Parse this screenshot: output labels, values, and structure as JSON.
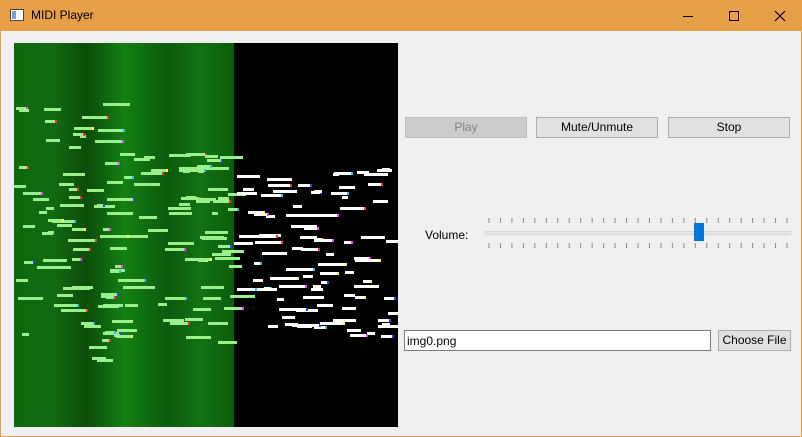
{
  "window": {
    "title": "MIDI Player",
    "titlebar_color": "#e8a048",
    "icons": {
      "app": "app-window-icon",
      "minimize": "minimize-icon",
      "maximize": "maximize-icon",
      "close": "close-icon"
    }
  },
  "controls": {
    "play_label": "Play",
    "play_enabled": false,
    "mute_label": "Mute/Unmute",
    "stop_label": "Stop"
  },
  "volume": {
    "label": "Volume:",
    "value": 0.7,
    "accent": "#0078d7"
  },
  "file": {
    "value": "img0.png",
    "choose_label": "Choose File"
  }
}
